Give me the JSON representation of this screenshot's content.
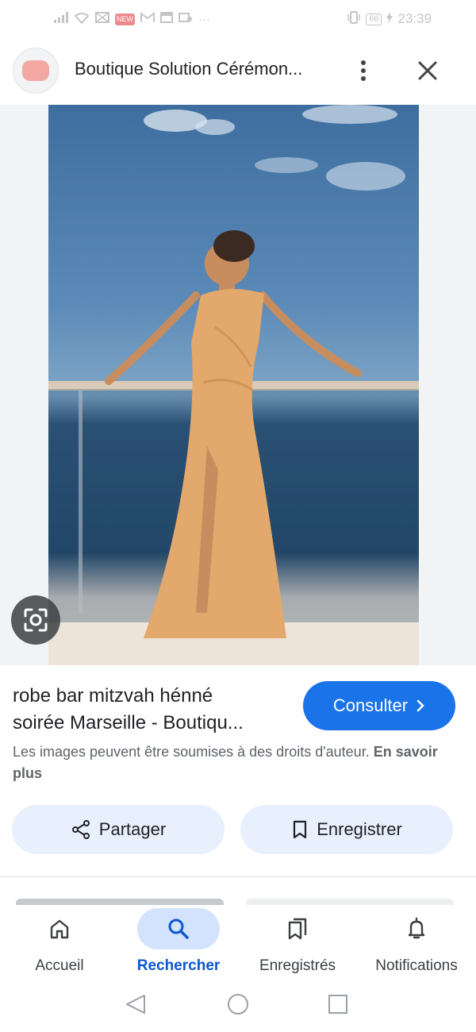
{
  "status_bar": {
    "time": "23:39",
    "battery": "66",
    "badge": "NEW"
  },
  "header": {
    "site_title": "Boutique Solution Cérémon...",
    "more_icon": "more-vert-icon",
    "close_icon": "close-icon"
  },
  "image": {
    "description_icon": "lens-search-icon"
  },
  "result": {
    "caption_line1": "robe bar mitzvah hénné",
    "caption_line2": "soirée Marseille - Boutiqu...",
    "consult_label": "Consulter",
    "copyright_text": "Les images peuvent être soumises à des droits d'auteur.",
    "learn_more": "En savoir plus"
  },
  "actions": {
    "share_label": "Partager",
    "save_label": "Enregistrer"
  },
  "bottom_nav": {
    "items": [
      {
        "label": "Accueil",
        "icon": "home-icon"
      },
      {
        "label": "Rechercher",
        "icon": "search-icon",
        "active": true
      },
      {
        "label": "Enregistrés",
        "icon": "collections-icon"
      },
      {
        "label": "Notifications",
        "icon": "bell-icon"
      }
    ]
  },
  "colors": {
    "accent": "#1a73e8",
    "active_nav_bg": "#d3e3fd",
    "action_bg": "#e8f0fe"
  }
}
